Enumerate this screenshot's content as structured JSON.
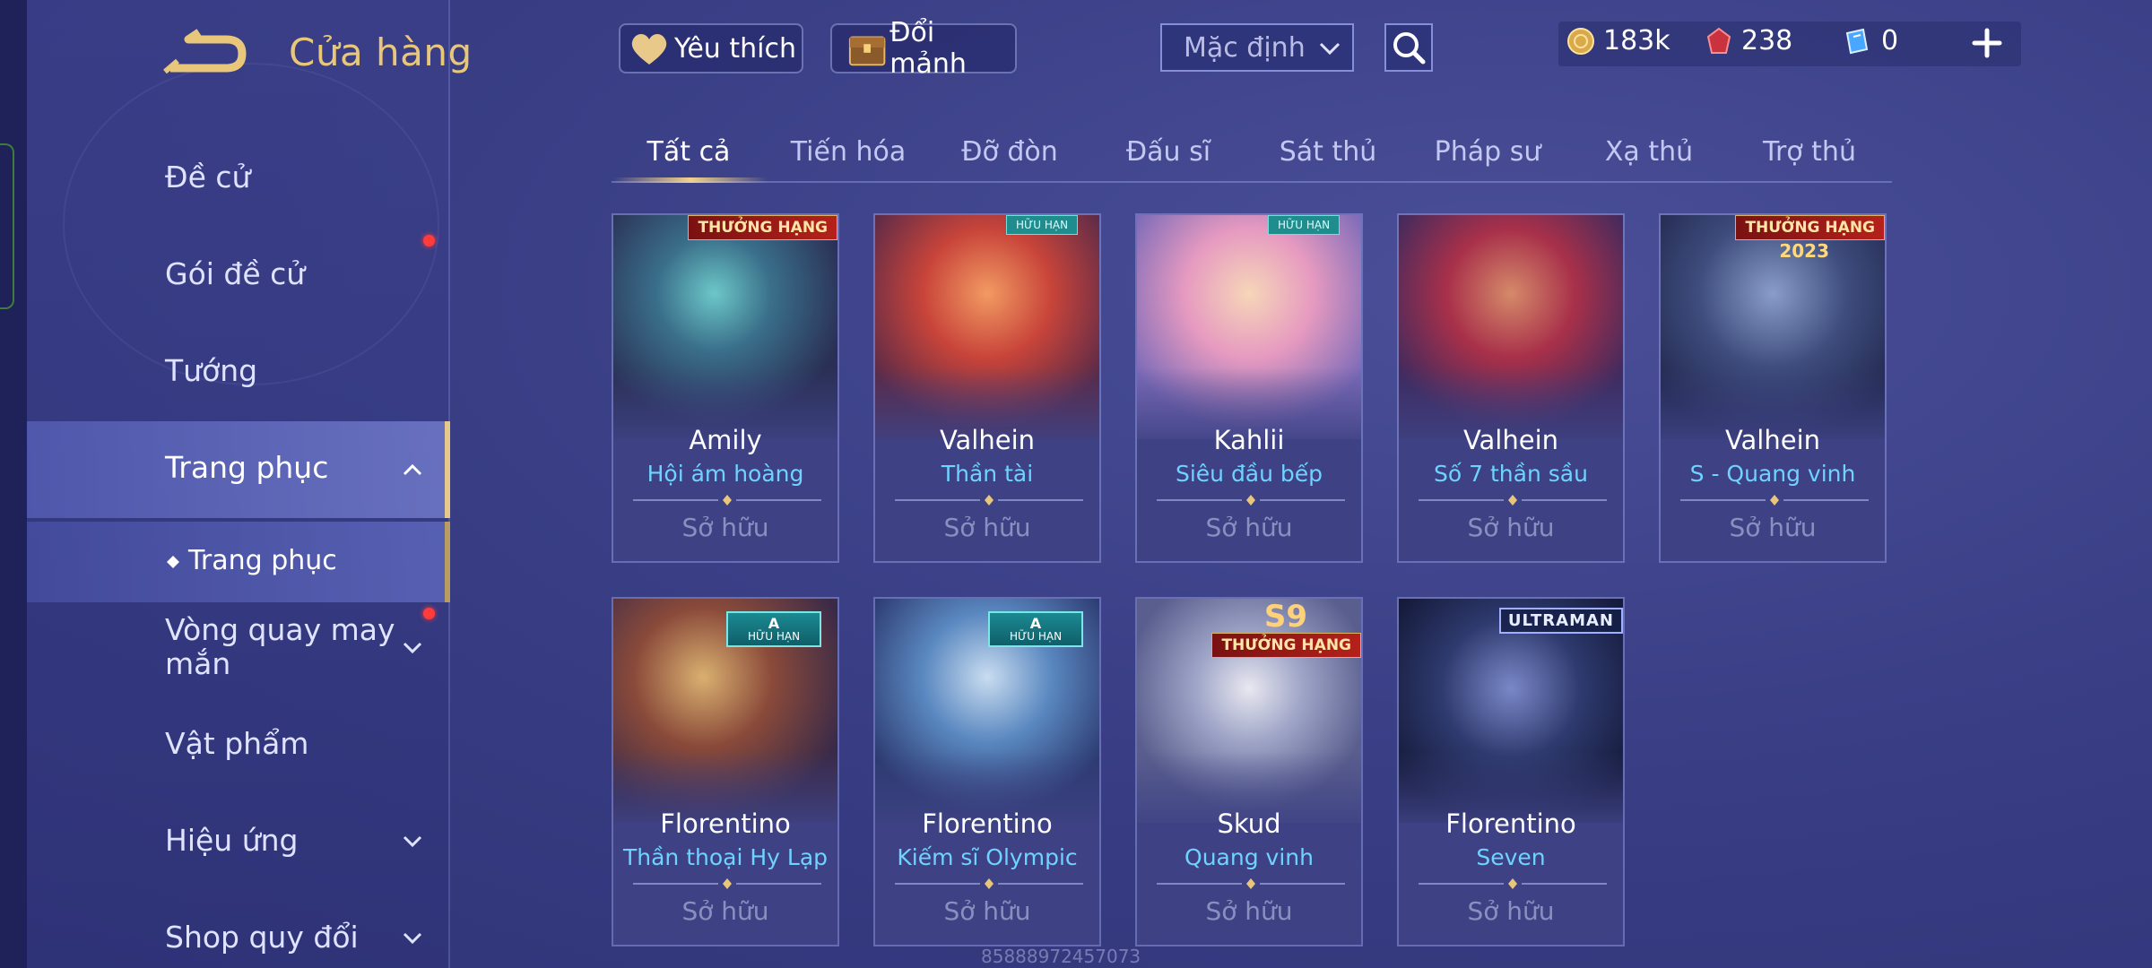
{
  "header": {
    "title": "Cửa hàng",
    "favorite_label": "Yêu thích",
    "exchange_label": "Đổi mảnh",
    "sort_value": "Mặc định",
    "currencies": [
      {
        "icon": "gold-coin-icon",
        "value": "183k"
      },
      {
        "icon": "ruby-gem-icon",
        "value": "238"
      },
      {
        "icon": "voucher-icon",
        "value": "0"
      }
    ]
  },
  "sidebar": {
    "items": [
      {
        "label": "Đề cử"
      },
      {
        "label": "Gói đề cử",
        "dot": true
      },
      {
        "label": "Tướng"
      },
      {
        "label": "Trang phục",
        "expanded": true
      },
      {
        "label": "Trang phục",
        "sub": true
      },
      {
        "label": "Vòng quay may mắn",
        "dot": true
      },
      {
        "label": "Vật phẩm"
      },
      {
        "label": "Hiệu ứng"
      },
      {
        "label": "Shop quy đổi"
      }
    ]
  },
  "tabs": [
    {
      "label": "Tất cả",
      "active": true
    },
    {
      "label": "Tiến hóa"
    },
    {
      "label": "Đỡ đòn"
    },
    {
      "label": "Đấu sĩ"
    },
    {
      "label": "Sát thủ"
    },
    {
      "label": "Pháp sư"
    },
    {
      "label": "Xạ thủ"
    },
    {
      "label": "Trợ thủ"
    }
  ],
  "cards": [
    {
      "hero": "Amily",
      "skin": "Hội ám hoàng",
      "status": "Sở hữu",
      "badge": "THƯỞNG HẠNG"
    },
    {
      "hero": "Valhein",
      "skin": "Thần tài",
      "status": "Sở hữu",
      "badge": "HỮU HẠN"
    },
    {
      "hero": "Kahlii",
      "skin": "Siêu đầu bếp",
      "status": "Sở hữu",
      "badge": "HỮU HẠN"
    },
    {
      "hero": "Valhein",
      "skin": "Số 7 thần sầu",
      "status": "Sở hữu"
    },
    {
      "hero": "Valhein",
      "skin": "S - Quang vinh",
      "status": "Sở hữu",
      "badge": "THƯỞNG HẠNG",
      "badge_sub": "2023"
    },
    {
      "hero": "Florentino",
      "skin": "Thần thoại Hy Lạp",
      "status": "Sở hữu",
      "badge_a": "A",
      "badge_a_sub": "HỮU HẠN"
    },
    {
      "hero": "Florentino",
      "skin": "Kiếm sĩ Olympic",
      "status": "Sở hữu",
      "badge_a": "A",
      "badge_a_sub": "HỮU HẠN"
    },
    {
      "hero": "Skud",
      "skin": "Quang vinh",
      "status": "Sở hữu",
      "badge": "THƯỞNG HẠNG",
      "badge_s9": "S9"
    },
    {
      "hero": "Florentino",
      "skin": "Seven",
      "status": "Sở hữu",
      "badge_ultra": "ULTRAMAN"
    }
  ],
  "watermark": "85888972457073",
  "colors": {
    "accent_gold": "#e8c77a",
    "skin_name": "#6fd2ff",
    "owned_text": "#8a8fc0",
    "badge_red": "#b5211b",
    "badge_teal": "#1f8c8e"
  }
}
